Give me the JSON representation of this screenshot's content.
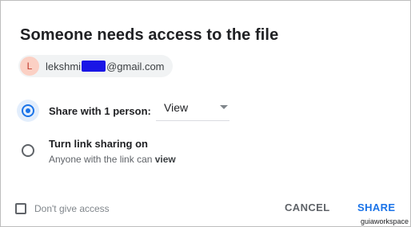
{
  "dialog": {
    "title": "Someone needs access to the file",
    "requester": {
      "avatar_letter": "L",
      "email_prefix": "lekshmi",
      "email_suffix": "@gmail.com"
    },
    "options": [
      {
        "label": "Share with 1 person:",
        "selected": true,
        "permission": "View"
      },
      {
        "label": "Turn link sharing on",
        "selected": false,
        "description_prefix": "Anyone with the link can ",
        "description_emphasis": "view"
      }
    ],
    "dont_give_access_label": "Don't give access",
    "cancel_label": "CANCEL",
    "share_label": "SHARE"
  },
  "watermark": "guiaworkspace",
  "colors": {
    "accent": "#1a73e8",
    "redaction": "#1a16e6",
    "avatar_bg": "#fbd0c4"
  }
}
